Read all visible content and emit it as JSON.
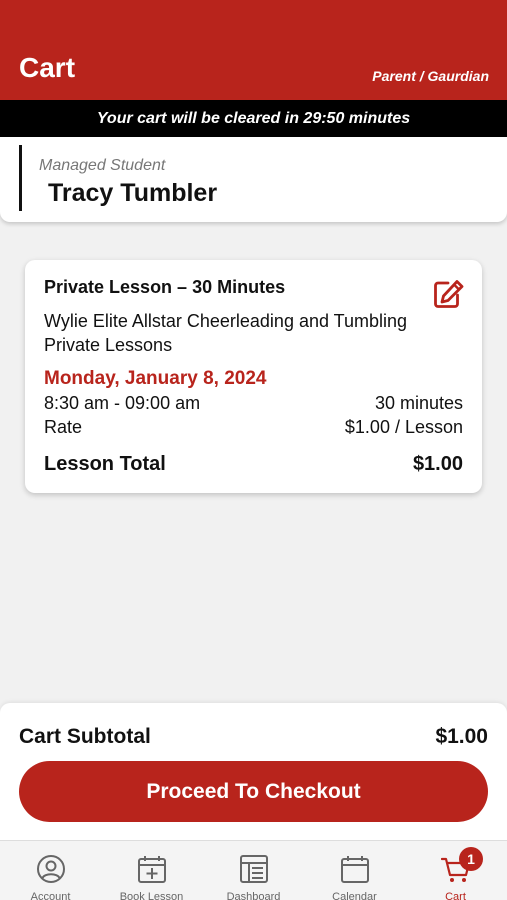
{
  "header": {
    "title": "Cart",
    "role": "Parent / Gaurdian"
  },
  "timer": {
    "text": "Your cart will be cleared in 29:50 minutes"
  },
  "student": {
    "label": "Managed Student",
    "name": "Tracy Tumbler"
  },
  "lesson": {
    "title": "Private Lesson – 30 Minutes",
    "organization": "Wylie Elite Allstar Cheerleading and Tumbling Private Lessons",
    "date": "Monday, January 8, 2024",
    "time": "8:30 am - 09:00 am",
    "duration": "30 minutes",
    "rate_label": "Rate",
    "rate_value": "$1.00 / Lesson",
    "total_label": "Lesson Total",
    "total_value": "$1.00"
  },
  "cart": {
    "subtotal_label": "Cart Subtotal",
    "subtotal_value": "$1.00",
    "checkout_label": "Proceed To Checkout"
  },
  "tabs": [
    {
      "label": "Account",
      "icon": "account-icon"
    },
    {
      "label": "Book Lesson",
      "icon": "calendar-plus-icon"
    },
    {
      "label": "Dashboard",
      "icon": "dashboard-icon"
    },
    {
      "label": "Calendar",
      "icon": "calendar-icon"
    },
    {
      "label": "Cart",
      "icon": "cart-icon"
    }
  ],
  "cart_badge": "1",
  "colors": {
    "brand": "#b8241c",
    "timer_bg": "#000000",
    "background": "#f1f1f1"
  }
}
